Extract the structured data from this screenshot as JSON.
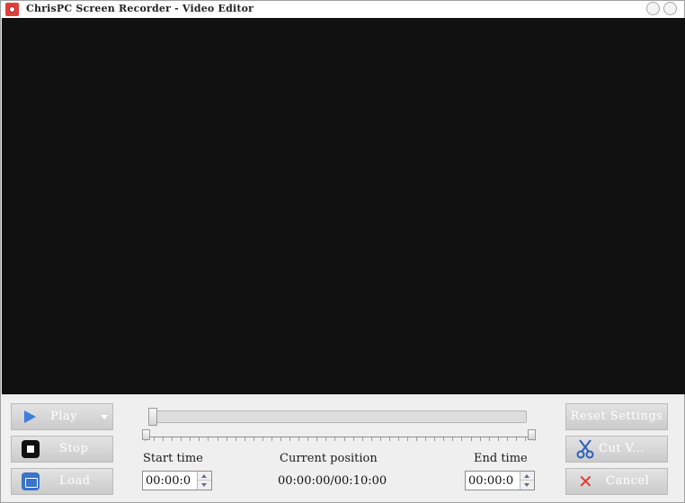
{
  "window": {
    "title": "ChrisPC Screen Recorder - Video Editor"
  },
  "buttons": {
    "play": "Play",
    "stop": "Stop",
    "load": "Load",
    "reset": "Reset Settings",
    "cut": "Cut V...",
    "cancel": "Cancel"
  },
  "timeline": {
    "playhead_fraction": 0.0,
    "range_start_fraction": 0.0,
    "range_end_fraction": 1.0
  },
  "labels": {
    "start_time": "Start time",
    "current_position": "Current position",
    "end_time": "End time"
  },
  "values": {
    "start_time": "00:00:0",
    "current_position": "00:00:00/00:10:00",
    "end_time": "00:00:0"
  },
  "icons": {
    "play": "play-icon",
    "stop": "stop-icon",
    "load": "folder-icon",
    "cut": "scissors-icon",
    "cancel": "x-icon"
  },
  "colors": {
    "video_background": "#111111",
    "button_text": "#ffffff",
    "play_accent": "#3d7ee0",
    "cancel_accent": "#e23a2e"
  }
}
